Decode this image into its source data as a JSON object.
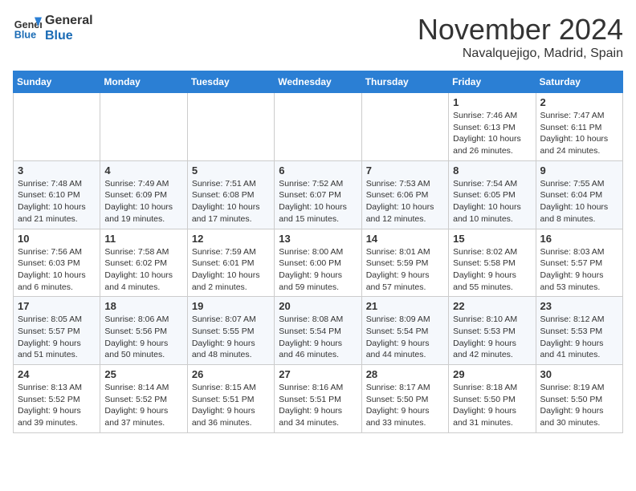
{
  "logo": {
    "line1": "General",
    "line2": "Blue"
  },
  "title": "November 2024",
  "location": "Navalquejigo, Madrid, Spain",
  "days_of_week": [
    "Sunday",
    "Monday",
    "Tuesday",
    "Wednesday",
    "Thursday",
    "Friday",
    "Saturday"
  ],
  "weeks": [
    [
      {
        "day": "",
        "info": ""
      },
      {
        "day": "",
        "info": ""
      },
      {
        "day": "",
        "info": ""
      },
      {
        "day": "",
        "info": ""
      },
      {
        "day": "",
        "info": ""
      },
      {
        "day": "1",
        "info": "Sunrise: 7:46 AM\nSunset: 6:13 PM\nDaylight: 10 hours and 26 minutes."
      },
      {
        "day": "2",
        "info": "Sunrise: 7:47 AM\nSunset: 6:11 PM\nDaylight: 10 hours and 24 minutes."
      }
    ],
    [
      {
        "day": "3",
        "info": "Sunrise: 7:48 AM\nSunset: 6:10 PM\nDaylight: 10 hours and 21 minutes."
      },
      {
        "day": "4",
        "info": "Sunrise: 7:49 AM\nSunset: 6:09 PM\nDaylight: 10 hours and 19 minutes."
      },
      {
        "day": "5",
        "info": "Sunrise: 7:51 AM\nSunset: 6:08 PM\nDaylight: 10 hours and 17 minutes."
      },
      {
        "day": "6",
        "info": "Sunrise: 7:52 AM\nSunset: 6:07 PM\nDaylight: 10 hours and 15 minutes."
      },
      {
        "day": "7",
        "info": "Sunrise: 7:53 AM\nSunset: 6:06 PM\nDaylight: 10 hours and 12 minutes."
      },
      {
        "day": "8",
        "info": "Sunrise: 7:54 AM\nSunset: 6:05 PM\nDaylight: 10 hours and 10 minutes."
      },
      {
        "day": "9",
        "info": "Sunrise: 7:55 AM\nSunset: 6:04 PM\nDaylight: 10 hours and 8 minutes."
      }
    ],
    [
      {
        "day": "10",
        "info": "Sunrise: 7:56 AM\nSunset: 6:03 PM\nDaylight: 10 hours and 6 minutes."
      },
      {
        "day": "11",
        "info": "Sunrise: 7:58 AM\nSunset: 6:02 PM\nDaylight: 10 hours and 4 minutes."
      },
      {
        "day": "12",
        "info": "Sunrise: 7:59 AM\nSunset: 6:01 PM\nDaylight: 10 hours and 2 minutes."
      },
      {
        "day": "13",
        "info": "Sunrise: 8:00 AM\nSunset: 6:00 PM\nDaylight: 9 hours and 59 minutes."
      },
      {
        "day": "14",
        "info": "Sunrise: 8:01 AM\nSunset: 5:59 PM\nDaylight: 9 hours and 57 minutes."
      },
      {
        "day": "15",
        "info": "Sunrise: 8:02 AM\nSunset: 5:58 PM\nDaylight: 9 hours and 55 minutes."
      },
      {
        "day": "16",
        "info": "Sunrise: 8:03 AM\nSunset: 5:57 PM\nDaylight: 9 hours and 53 minutes."
      }
    ],
    [
      {
        "day": "17",
        "info": "Sunrise: 8:05 AM\nSunset: 5:57 PM\nDaylight: 9 hours and 51 minutes."
      },
      {
        "day": "18",
        "info": "Sunrise: 8:06 AM\nSunset: 5:56 PM\nDaylight: 9 hours and 50 minutes."
      },
      {
        "day": "19",
        "info": "Sunrise: 8:07 AM\nSunset: 5:55 PM\nDaylight: 9 hours and 48 minutes."
      },
      {
        "day": "20",
        "info": "Sunrise: 8:08 AM\nSunset: 5:54 PM\nDaylight: 9 hours and 46 minutes."
      },
      {
        "day": "21",
        "info": "Sunrise: 8:09 AM\nSunset: 5:54 PM\nDaylight: 9 hours and 44 minutes."
      },
      {
        "day": "22",
        "info": "Sunrise: 8:10 AM\nSunset: 5:53 PM\nDaylight: 9 hours and 42 minutes."
      },
      {
        "day": "23",
        "info": "Sunrise: 8:12 AM\nSunset: 5:53 PM\nDaylight: 9 hours and 41 minutes."
      }
    ],
    [
      {
        "day": "24",
        "info": "Sunrise: 8:13 AM\nSunset: 5:52 PM\nDaylight: 9 hours and 39 minutes."
      },
      {
        "day": "25",
        "info": "Sunrise: 8:14 AM\nSunset: 5:52 PM\nDaylight: 9 hours and 37 minutes."
      },
      {
        "day": "26",
        "info": "Sunrise: 8:15 AM\nSunset: 5:51 PM\nDaylight: 9 hours and 36 minutes."
      },
      {
        "day": "27",
        "info": "Sunrise: 8:16 AM\nSunset: 5:51 PM\nDaylight: 9 hours and 34 minutes."
      },
      {
        "day": "28",
        "info": "Sunrise: 8:17 AM\nSunset: 5:50 PM\nDaylight: 9 hours and 33 minutes."
      },
      {
        "day": "29",
        "info": "Sunrise: 8:18 AM\nSunset: 5:50 PM\nDaylight: 9 hours and 31 minutes."
      },
      {
        "day": "30",
        "info": "Sunrise: 8:19 AM\nSunset: 5:50 PM\nDaylight: 9 hours and 30 minutes."
      }
    ]
  ]
}
